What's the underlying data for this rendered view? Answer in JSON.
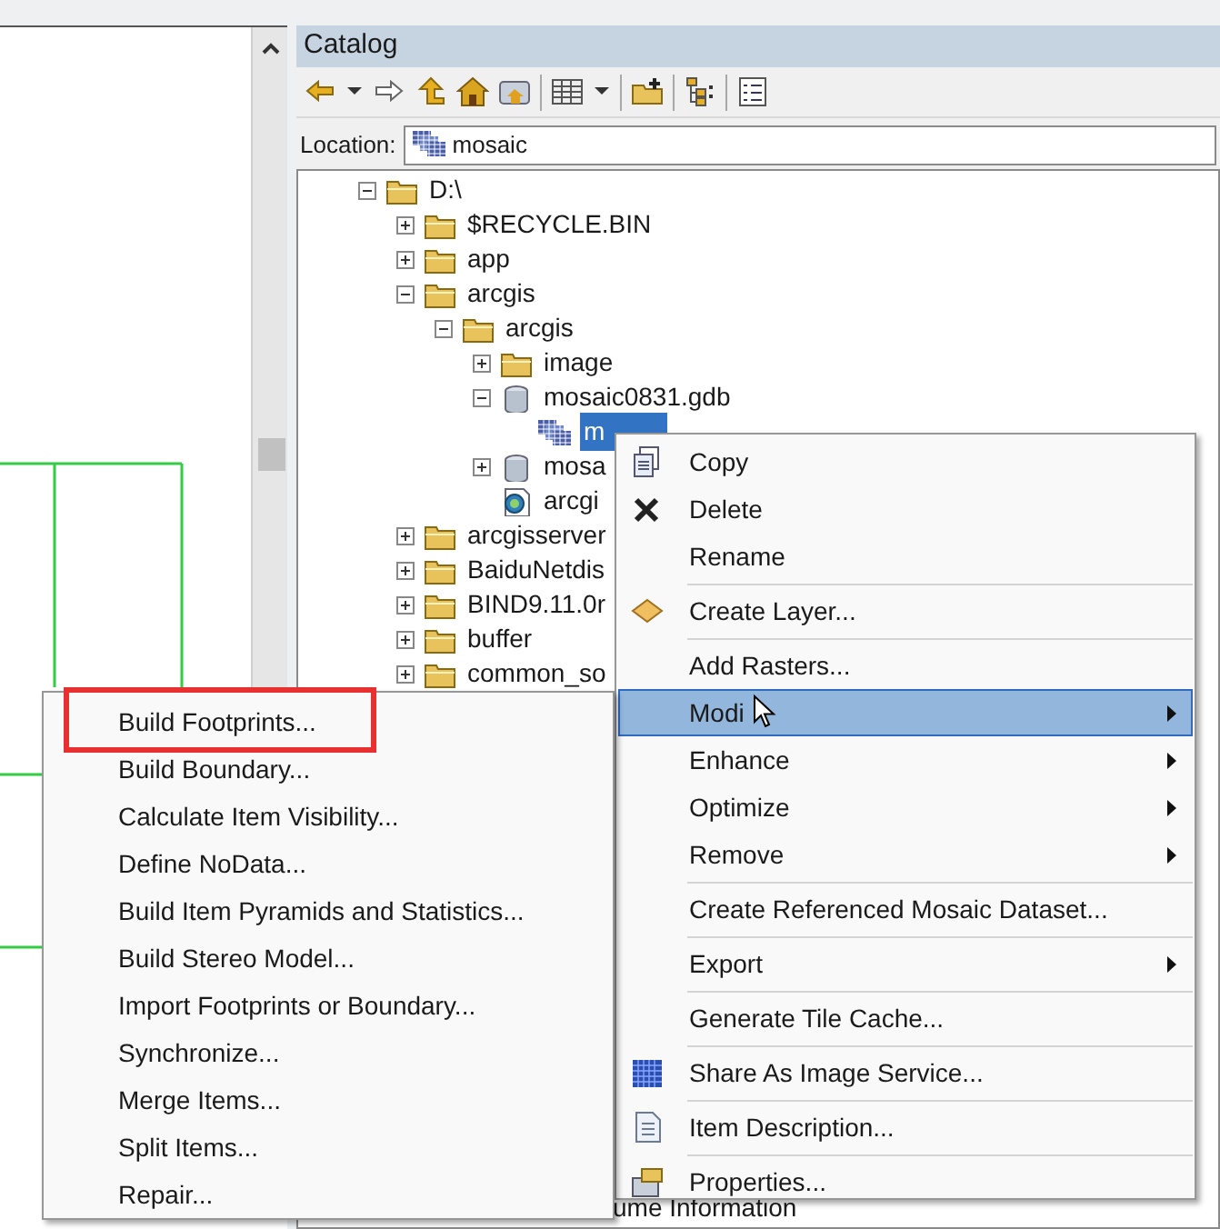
{
  "catalog": {
    "title": "Catalog",
    "location_label": "Location:",
    "location_value": "mosaic",
    "tree": [
      {
        "label": "D:\\",
        "kind": "folder",
        "expanded": true,
        "selected": false,
        "children": [
          {
            "label": "$RECYCLE.BIN",
            "kind": "folder",
            "expanded": false,
            "selected": false
          },
          {
            "label": "app",
            "kind": "folder",
            "expanded": false,
            "selected": false
          },
          {
            "label": "arcgis",
            "kind": "folder",
            "expanded": true,
            "selected": false,
            "children": [
              {
                "label": "arcgis",
                "kind": "folder",
                "expanded": true,
                "selected": false,
                "children": [
                  {
                    "label": "image",
                    "kind": "folder",
                    "expanded": false,
                    "selected": false
                  },
                  {
                    "label": "mosaic0831.gdb",
                    "kind": "database",
                    "expanded": true,
                    "selected": false,
                    "children": [
                      {
                        "label": "m",
                        "kind": "dataset",
                        "selected": true
                      }
                    ]
                  },
                  {
                    "label": "mosa",
                    "kind": "database",
                    "expanded": false,
                    "selected": false
                  },
                  {
                    "label": "arcgi",
                    "kind": "document",
                    "selected": false
                  }
                ]
              }
            ]
          },
          {
            "label": "arcgisserver",
            "kind": "folder",
            "expanded": false,
            "selected": false
          },
          {
            "label": "BaiduNetdis",
            "kind": "folder",
            "expanded": false,
            "selected": false
          },
          {
            "label": "BIND9.11.0r",
            "kind": "folder",
            "expanded": false,
            "selected": false
          },
          {
            "label": "buffer",
            "kind": "folder",
            "expanded": false,
            "selected": false
          },
          {
            "label": "common_so",
            "kind": "folder",
            "expanded": false,
            "selected": false
          }
        ]
      }
    ],
    "tree_tail": "ume Information"
  },
  "context_menu": [
    {
      "kind": "item",
      "label": "Copy",
      "submenu": false,
      "selected": false
    },
    {
      "kind": "item",
      "label": "Delete",
      "submenu": false,
      "selected": false
    },
    {
      "kind": "item",
      "label": "Rename",
      "submenu": false,
      "selected": false
    },
    {
      "kind": "separator"
    },
    {
      "kind": "item",
      "label": "Create Layer...",
      "submenu": false,
      "selected": false
    },
    {
      "kind": "separator"
    },
    {
      "kind": "item",
      "label": "Add Rasters...",
      "submenu": false,
      "selected": false
    },
    {
      "kind": "item",
      "label": "Modi",
      "submenu": true,
      "selected": true
    },
    {
      "kind": "item",
      "label": "Enhance",
      "submenu": true,
      "selected": false
    },
    {
      "kind": "item",
      "label": "Optimize",
      "submenu": true,
      "selected": false
    },
    {
      "kind": "item",
      "label": "Remove",
      "submenu": true,
      "selected": false
    },
    {
      "kind": "separator"
    },
    {
      "kind": "item",
      "label": "Create Referenced Mosaic Dataset...",
      "submenu": false,
      "selected": false
    },
    {
      "kind": "separator"
    },
    {
      "kind": "item",
      "label": "Export",
      "submenu": true,
      "selected": false
    },
    {
      "kind": "separator"
    },
    {
      "kind": "item",
      "label": "Generate Tile Cache...",
      "submenu": false,
      "selected": false
    },
    {
      "kind": "separator"
    },
    {
      "kind": "item",
      "label": "Share As Image Service...",
      "submenu": false,
      "selected": false
    },
    {
      "kind": "separator"
    },
    {
      "kind": "item",
      "label": "Item Description...",
      "submenu": false,
      "selected": false
    },
    {
      "kind": "separator"
    },
    {
      "kind": "item",
      "label": "Properties...",
      "submenu": false,
      "selected": false
    }
  ],
  "modify_submenu": [
    {
      "label": "Build Footprints...",
      "annotated": true
    },
    {
      "label": "Build Boundary...",
      "annotated": false
    },
    {
      "label": "Calculate Item Visibility...",
      "annotated": false
    },
    {
      "label": "Define NoData...",
      "annotated": false
    },
    {
      "label": "Build Item Pyramids and Statistics...",
      "annotated": false
    },
    {
      "label": "Build Stereo Model...",
      "annotated": false
    },
    {
      "label": "Import Footprints or Boundary...",
      "annotated": false
    },
    {
      "label": "Synchronize...",
      "annotated": false
    },
    {
      "label": "Merge Items...",
      "annotated": false
    },
    {
      "label": "Split Items...",
      "annotated": false
    },
    {
      "label": "Repair...",
      "annotated": false
    }
  ]
}
